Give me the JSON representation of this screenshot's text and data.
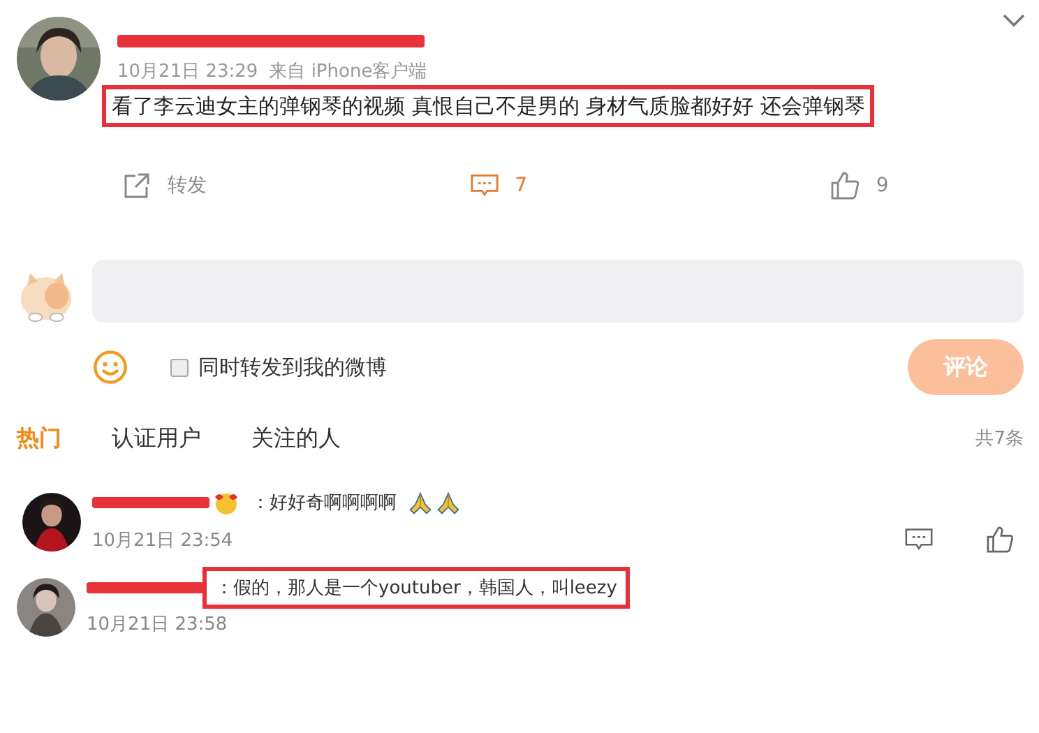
{
  "post": {
    "name_redacted": true,
    "time": "10月21日 23:29",
    "source": "来自 iPhone客户端",
    "text": "看了李云迪女主的弹钢琴的视频 真恨自己不是男的 身材气质脸都好好 还会弹钢琴",
    "highlighted": true
  },
  "actions": [
    {
      "kind": "repost",
      "label": "转发",
      "active": false
    },
    {
      "kind": "comment",
      "label": "7",
      "active": true
    },
    {
      "kind": "like",
      "label": "9",
      "active": false
    }
  ],
  "composer": {
    "share_label": "同时转发到我的微博",
    "share_checked": false,
    "submit": "评论",
    "submit_disabled": true
  },
  "tabs": [
    {
      "label": "热门",
      "selected": true
    },
    {
      "label": "认证用户",
      "selected": false
    },
    {
      "label": "关注的人",
      "selected": false
    }
  ],
  "total": "共7条",
  "comments": [
    {
      "name_redacted": true,
      "emoji": true,
      "text": "：好好奇啊啊啊啊",
      "time": "10月21日 23:54",
      "highlighted": false,
      "actions": true
    },
    {
      "name_redacted": true,
      "emoji": false,
      "text": "：假的，那人是一个youtuber，韩国人，叫leezy",
      "time": "10月21日 23:58",
      "highlighted": true,
      "actions": false
    }
  ]
}
